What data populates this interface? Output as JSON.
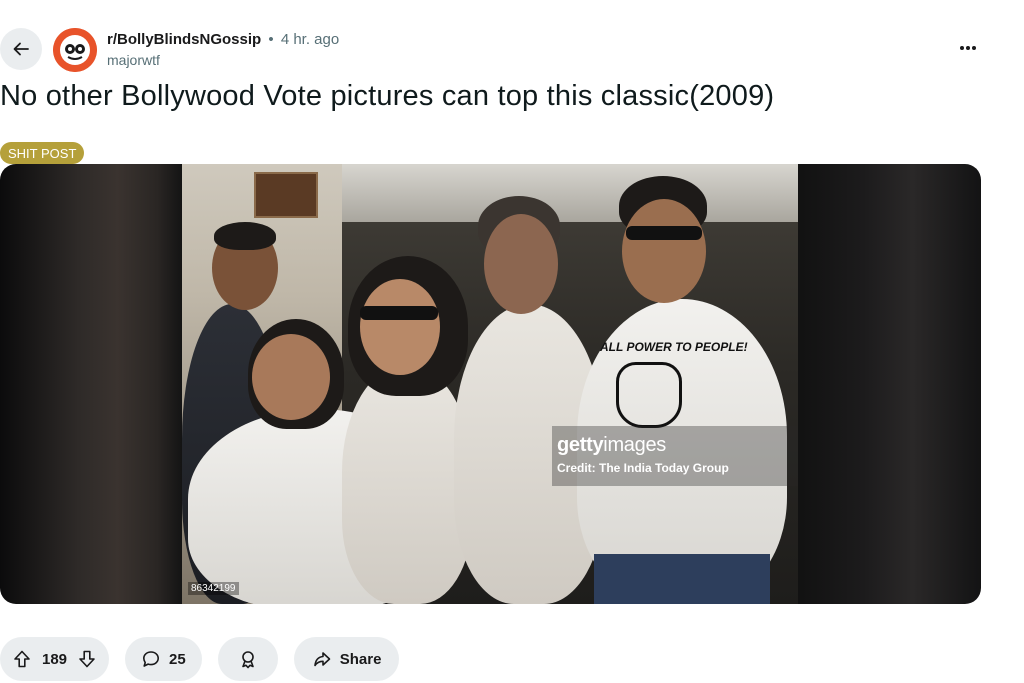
{
  "post": {
    "subreddit": "r/BollyBlindsNGossip",
    "separator": "•",
    "time_ago": "4 hr. ago",
    "author": "majorwtf",
    "title": "No other Bollywood Vote pictures can top this classic(2009)",
    "flair": "SHIT POST"
  },
  "media": {
    "watermark_brand_bold": "getty",
    "watermark_brand_light": "images",
    "watermark_credit": "Credit: The India Today Group",
    "image_id": "86342199",
    "tshirt_text": "ALL POWER TO PEOPLE!"
  },
  "actions": {
    "upvotes": "189",
    "comments": "25",
    "share_label": "Share"
  },
  "icons": {
    "back": "arrow-left-icon",
    "more": "more-horizontal-icon",
    "upvote": "arrow-up-icon",
    "downvote": "arrow-down-icon",
    "comment": "speech-bubble-icon",
    "award": "award-ribbon-icon",
    "share": "share-arrow-icon"
  },
  "colors": {
    "flair_bg": "#b5a03a",
    "subreddit_avatar": "#e8532a",
    "pill_bg": "#eaedef"
  }
}
